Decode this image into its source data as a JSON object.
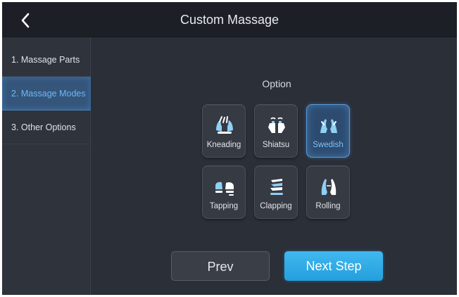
{
  "header": {
    "title": "Custom Massage",
    "back_icon": "chevron-left-icon"
  },
  "sidebar": {
    "items": [
      {
        "label": "1. Massage Parts",
        "active": false
      },
      {
        "label": "2. Massage Modes",
        "active": true
      },
      {
        "label": "3. Other Options",
        "active": false
      }
    ]
  },
  "main": {
    "option_label": "Option",
    "modes": [
      {
        "label": "Kneading",
        "icon": "kneading-hands-icon",
        "selected": false
      },
      {
        "label": "Shiatsu",
        "icon": "shiatsu-hands-icon",
        "selected": false
      },
      {
        "label": "Swedish",
        "icon": "swedish-hands-icon",
        "selected": true
      },
      {
        "label": "Tapping",
        "icon": "tapping-hands-icon",
        "selected": false
      },
      {
        "label": "Clapping",
        "icon": "clapping-hands-icon",
        "selected": false
      },
      {
        "label": "Rolling",
        "icon": "rolling-hands-icon",
        "selected": false
      }
    ]
  },
  "buttons": {
    "prev": "Prev",
    "next": "Next Step"
  },
  "colors": {
    "accent": "#2ba6e2",
    "selected_text": "#7fc2f5",
    "background": "#2b2f38"
  }
}
